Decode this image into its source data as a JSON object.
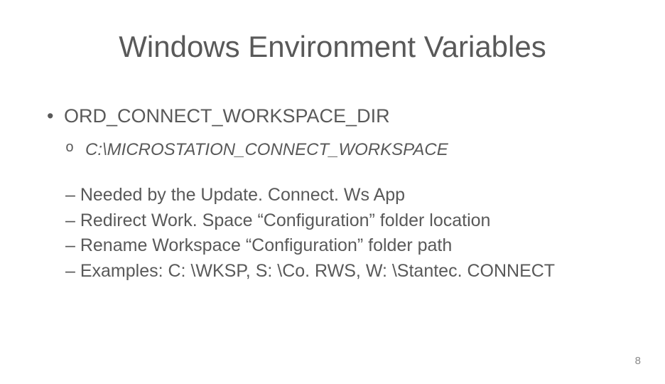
{
  "slide": {
    "title": "Windows Environment Variables",
    "bullet1": "ORD_CONNECT_WORKSPACE_DIR",
    "subbullet1": "C:\\MICROSTATION_CONNECT_WORKSPACE",
    "dashes": [
      "– Needed by the Update. Connect. Ws App",
      "– Redirect Work. Space “Configuration” folder location",
      "– Rename Workspace “Configuration” folder path",
      "– Examples: C: \\WKSP, S: \\Co. RWS, W: \\Stantec. CONNECT"
    ],
    "page_number": "8"
  }
}
